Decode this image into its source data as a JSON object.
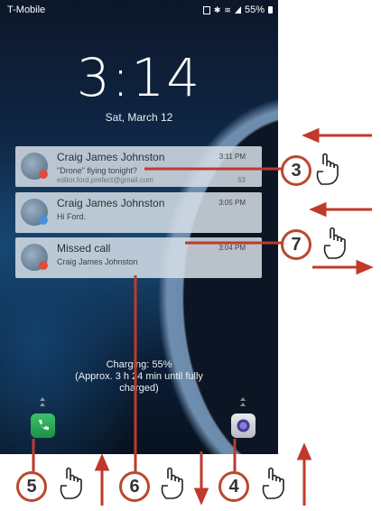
{
  "status_bar": {
    "carrier": "T-Mobile",
    "battery": "55%",
    "icons": [
      "nfc-icon",
      "bluetooth-icon",
      "signal-icon",
      "battery-icon"
    ]
  },
  "lockscreen": {
    "time": "3:14",
    "date": "Sat, March 12"
  },
  "notifications": [
    {
      "title": "Craig James Johnston",
      "time": "3:11 PM",
      "line1": "\"Drone\" flying tonight?",
      "line2": "editor.ford.prefect@gmail.com",
      "count": "63",
      "badge_color": "#e24a3b"
    },
    {
      "title": "Craig James Johnston",
      "time": "3:05 PM",
      "line1": "Hi Ford.",
      "badge_color": "#4a90d9"
    },
    {
      "title": "Missed call",
      "time": "3:04 PM",
      "line1": "Craig James Johnston",
      "badge_color": "#e24a3b"
    }
  ],
  "charging": {
    "line1": "Charging: 55%",
    "line2": "(Approx. 3 h 24 min until fully",
    "line3": "charged)"
  },
  "shortcuts": {
    "left": "phone-icon",
    "right": "camera-icon"
  },
  "callouts": {
    "c3": "3",
    "c7": "7",
    "c5": "5",
    "c6": "6",
    "c4": "4"
  },
  "colors": {
    "callout_ring": "#b9492b",
    "arrow": "#c0392b"
  }
}
